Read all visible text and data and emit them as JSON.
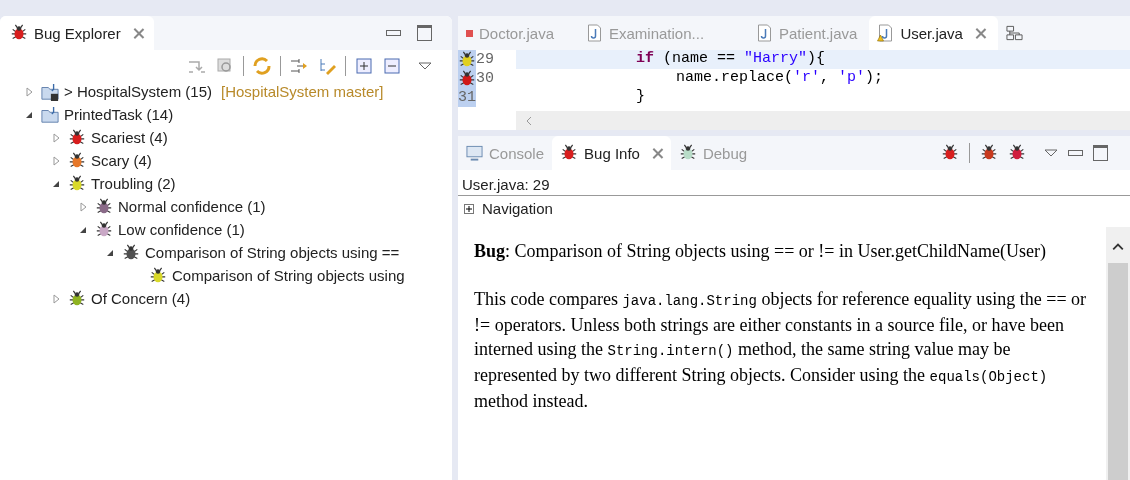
{
  "explorer": {
    "title": "Bug Explorer",
    "tree": [
      {
        "kind": "project",
        "label": "> HospitalSystem (15)",
        "decoration": "[HospitalSystem master]",
        "expanded": false
      },
      {
        "kind": "folder",
        "label": "PrintedTask (14)",
        "expanded": true,
        "children": [
          {
            "kind": "bug",
            "color": "#d81e1e",
            "label": "Scariest (4)",
            "expanded": false
          },
          {
            "kind": "bug",
            "color": "#e6782a",
            "label": "Scary (4)",
            "expanded": false
          },
          {
            "kind": "bug",
            "color": "#d9d92a",
            "label": "Troubling (2)",
            "expanded": true,
            "children": [
              {
                "kind": "bug",
                "color": "#8a6a88",
                "label": "Normal confidence (1)",
                "expanded": false
              },
              {
                "kind": "bug",
                "color": "#c9a8c6",
                "label": "Low confidence (1)",
                "expanded": true,
                "children": [
                  {
                    "kind": "bug",
                    "color": "#505050",
                    "label": "Comparison of String objects using ==",
                    "expanded": true,
                    "children": [
                      {
                        "kind": "bug",
                        "color": "#d9d92a",
                        "label": "Comparison of String objects using"
                      }
                    ]
                  }
                ]
              }
            ]
          },
          {
            "kind": "bug",
            "color": "#8fb321",
            "label": "Of Concern (4)",
            "expanded": false
          }
        ]
      }
    ]
  },
  "editor": {
    "tabs": [
      {
        "kind": "modified",
        "label": "Doctor.java",
        "selected": false
      },
      {
        "kind": "java",
        "label": "Examination...",
        "selected": false
      },
      {
        "kind": "java",
        "label": "Patient.java",
        "selected": false
      },
      {
        "kind": "warning",
        "label": "User.java",
        "selected": true
      },
      {
        "kind": "hierarchy",
        "selected": false
      }
    ],
    "lines": [
      {
        "number": "29",
        "color": "#e0d020",
        "highlighted": true,
        "tokens": [
          {
            "kind": "keyword",
            "text": "if"
          },
          {
            "kind": "plain",
            "text": " (name == "
          },
          {
            "kind": "string",
            "text": "\"Harry\""
          },
          {
            "kind": "plain",
            "text": "){"
          }
        ],
        "indented": false
      },
      {
        "number": "30",
        "color": "#d01818",
        "highlighted": false,
        "tokens": [
          {
            "kind": "plain",
            "text": "name.replace("
          },
          {
            "kind": "string",
            "text": "'r'"
          },
          {
            "kind": "plain",
            "text": ", "
          },
          {
            "kind": "string",
            "text": "'p'"
          },
          {
            "kind": "plain",
            "text": ");"
          }
        ],
        "indented": true
      },
      {
        "number": "31",
        "highlighted": false,
        "tokens": [
          {
            "kind": "plain",
            "text": "}"
          }
        ],
        "indented": false
      }
    ]
  },
  "bottom": {
    "tabs": [
      {
        "kind": "console",
        "label": "Console",
        "selected": false
      },
      {
        "kind": "bug",
        "label": "Bug Info",
        "selected": true
      },
      {
        "kind": "debug",
        "label": "Debug",
        "selected": false
      }
    ],
    "location": "User.java: 29",
    "navigation": {
      "label": "Navigation",
      "expanded": false
    },
    "heading": "**Bug**: Comparison of String objects using == or != in User.getChildName(User)",
    "description": [
      {
        "kind": "text",
        "text": "This code compares "
      },
      {
        "kind": "code",
        "text": "java.lang.String"
      },
      {
        "kind": "text",
        "text": " objects for reference equality using the == or != operators. Unless both strings are either constants in a source file, or have been interned using the "
      },
      {
        "kind": "code",
        "text": "String.intern()"
      },
      {
        "kind": "text",
        "text": " method, the same string value may be represented by two different String objects. Consider using the "
      },
      {
        "kind": "code",
        "text": "equals(Object)"
      },
      {
        "kind": "text",
        "text": " method instead."
      }
    ]
  }
}
